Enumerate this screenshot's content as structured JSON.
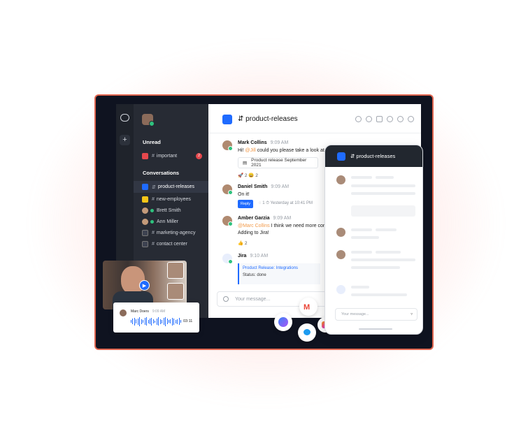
{
  "sidebar": {
    "unread_title": "Unread",
    "unread_items": [
      {
        "label": "important",
        "badge": "2",
        "color": "#e5484d"
      }
    ],
    "conversations_title": "Conversations",
    "items": [
      {
        "label": "product-releases",
        "type": "channel",
        "color": "#1f6bff",
        "active": true
      },
      {
        "label": "new-employees",
        "type": "channel",
        "color": "#f5c518"
      },
      {
        "label": "Brett Smith",
        "type": "user",
        "status": "#2ec27e"
      },
      {
        "label": "Ann Miller",
        "type": "user",
        "status": "#2ec27e"
      },
      {
        "label": "marketing-agency",
        "type": "group"
      },
      {
        "label": "contact center",
        "type": "group"
      }
    ]
  },
  "channel": {
    "name": "product-releases",
    "color": "#1f6bff"
  },
  "messages": [
    {
      "author": "Mark Collins",
      "time": "9:09 AM",
      "pre": "Hi! ",
      "mention": "@Jill",
      "post": " could you please take a look at this",
      "file": "Product release September 2021",
      "reactions": "🚀 2    😄 2"
    },
    {
      "author": "Daniel Smith",
      "time": "9:09 AM",
      "text": "On it!",
      "reply": "Reply",
      "thread_count": "1",
      "thread_time": "Yesterday at 10:41 PM"
    },
    {
      "author": "Amber Garzia",
      "time": "9:09 AM",
      "mention": "@Marc Collins",
      "post": " I think we need more conte",
      "text2": "Adding to Jira!",
      "reactions": "👍 2"
    },
    {
      "author": "Jira",
      "time": "9:10 AM",
      "card_title": "Product Release: Integrations",
      "card_status": "Status: done"
    }
  ],
  "composer": {
    "placeholder": "Your message..."
  },
  "voice": {
    "name": "Marc Doers",
    "time": "9:09 AM",
    "duration": "03:11"
  },
  "phone": {
    "channel": "product-releases",
    "placeholder": "Your message..."
  },
  "icons": [
    "chat-logo-icon",
    "plus-icon",
    "globe-icon",
    "info-icon",
    "share-icon",
    "whatsapp-icon",
    "phone-icon",
    "users-icon",
    "more-icon",
    "emoji-icon",
    "play-icon",
    "gmail-icon",
    "messenger-icon",
    "twitter-icon",
    "instagram-icon",
    "send-icon",
    "file-icon"
  ],
  "brand_colors": {
    "accent": "#1f6bff",
    "device_border": "#e0654f",
    "online": "#2ec27e",
    "badge": "#e5484d"
  }
}
